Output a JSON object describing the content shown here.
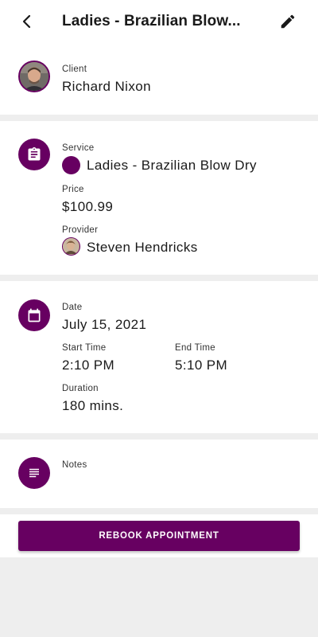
{
  "header": {
    "title": "Ladies - Brazilian Blow...",
    "back_icon": "chevron-left-icon",
    "edit_icon": "pencil-icon"
  },
  "client": {
    "label": "Client",
    "name": "Richard Nixon"
  },
  "service": {
    "label": "Service",
    "name": "Ladies - Brazilian Blow Dry",
    "color": "#670061",
    "price_label": "Price",
    "price": "$100.99",
    "provider_label": "Provider",
    "provider": "Steven Hendricks",
    "icon": "clipboard-icon"
  },
  "schedule": {
    "date_label": "Date",
    "date": "July 15, 2021",
    "start_label": "Start Time",
    "start": "2:10 PM",
    "end_label": "End Time",
    "end": "5:10 PM",
    "duration_label": "Duration",
    "duration": "180 mins.",
    "icon": "calendar-icon"
  },
  "notes": {
    "label": "Notes",
    "icon": "notes-icon"
  },
  "actions": {
    "rebook_label": "REBOOK APPOINTMENT"
  },
  "theme": {
    "accent": "#670061",
    "background": "#eeeeee"
  }
}
